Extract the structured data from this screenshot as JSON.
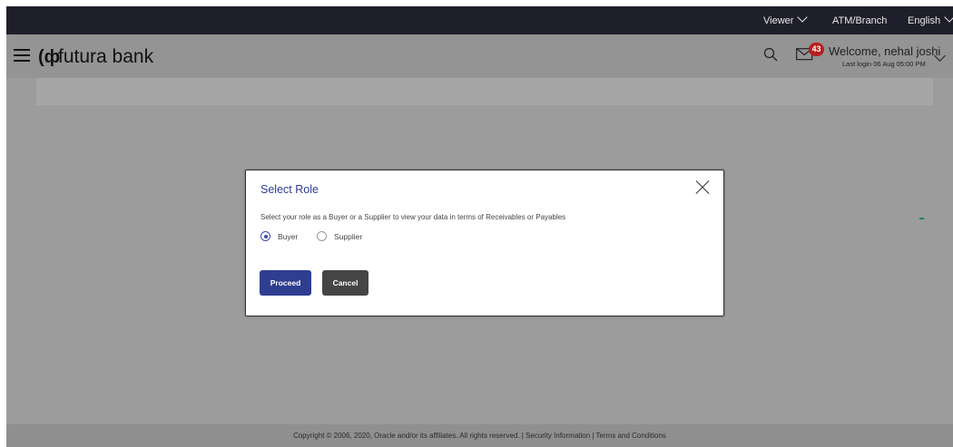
{
  "topbar": {
    "viewer_label": "Viewer",
    "atm_branch_label": "ATM/Branch",
    "language_label": "English"
  },
  "header": {
    "brand_name": "futura bank",
    "logo_mark": "(ф",
    "mail_count": "43",
    "welcome_text": "Welcome, nehal joshi",
    "last_login": "Last login 06 Aug 05:00 PM"
  },
  "modal": {
    "title": "Select Role",
    "description": "Select your role as a Buyer or a Supplier to view your data in terms of Receivables or Payables",
    "options": [
      {
        "label": "Buyer",
        "selected": true
      },
      {
        "label": "Supplier",
        "selected": false
      }
    ],
    "proceed_label": "Proceed",
    "cancel_label": "Cancel"
  },
  "footer": {
    "copyright": "Copyright © 2006, 2020, Oracle and/or its affiliates. All rights reserved. | Security Information | Terms and Conditions"
  },
  "colors": {
    "topbar_bg": "#1f1f2b",
    "overlay_bg": "#9c9c9c",
    "primary": "#2f3e8f",
    "cancel": "#454545",
    "badge": "#b81d1d"
  },
  "icons": [
    "hamburger-icon",
    "search-icon",
    "mail-icon",
    "close-icon",
    "chevron-down-icon"
  ]
}
